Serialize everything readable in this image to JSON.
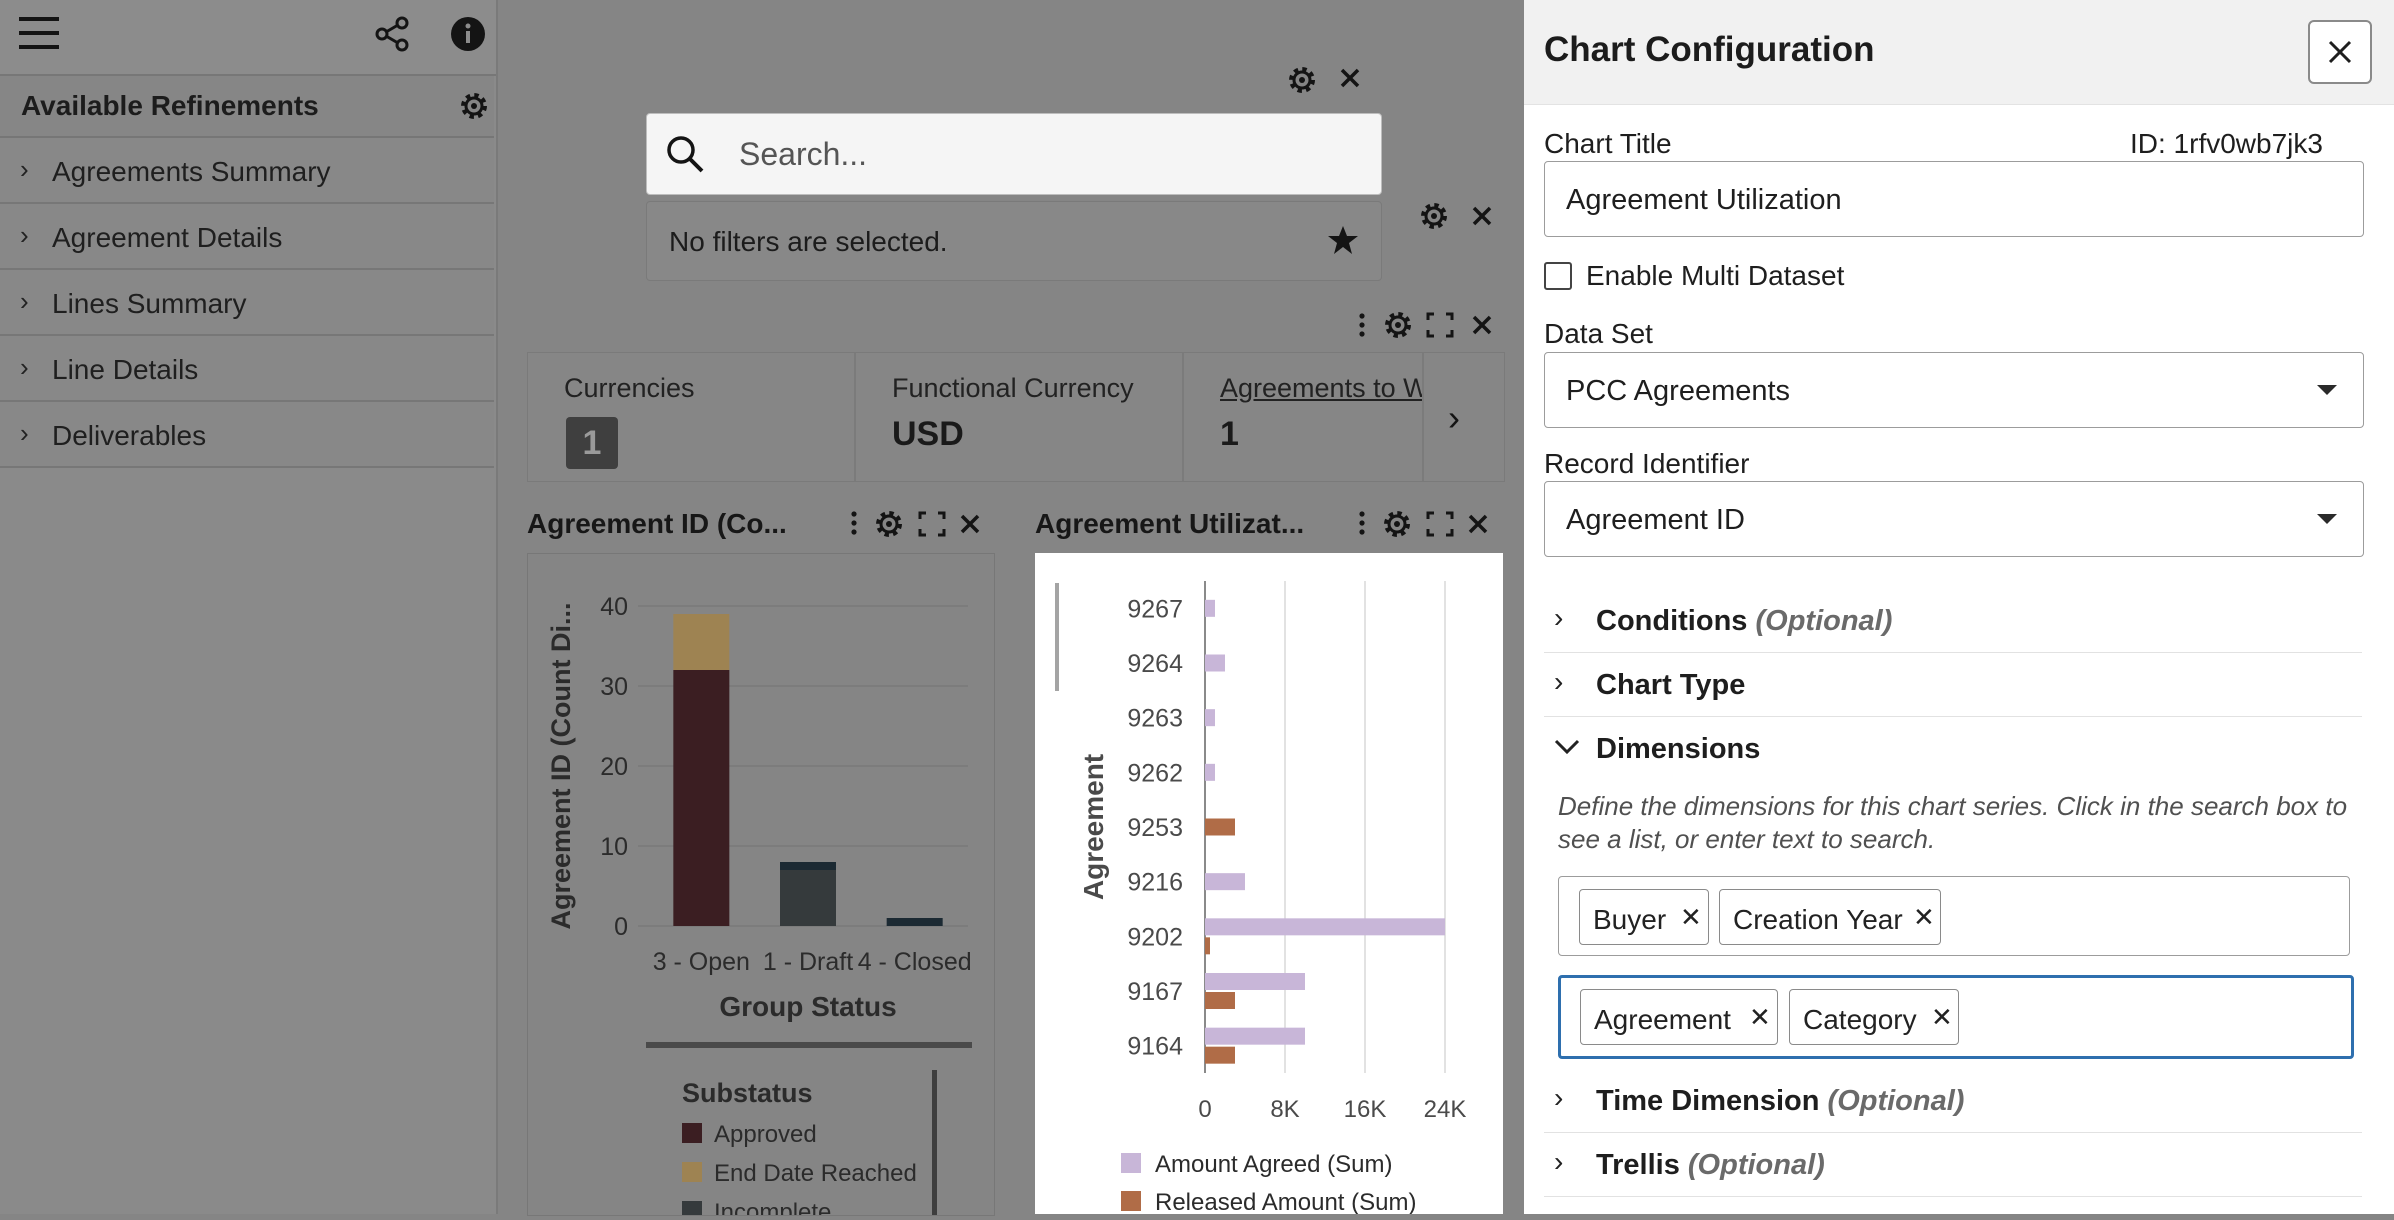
{
  "sidebar": {
    "heading": "Available Refinements",
    "items": [
      {
        "label": "Agreements Summary"
      },
      {
        "label": "Agreement Details"
      },
      {
        "label": "Lines Summary"
      },
      {
        "label": "Line Details"
      },
      {
        "label": "Deliverables"
      }
    ]
  },
  "search": {
    "placeholder": "Search..."
  },
  "filters": {
    "text": "No filters are selected."
  },
  "summary": {
    "cells": [
      {
        "header": "Currencies",
        "value": "1"
      },
      {
        "header": "Functional Currency",
        "value": "USD"
      },
      {
        "header": "Agreements to W",
        "value": "1"
      }
    ]
  },
  "chart_panels": [
    {
      "title": "Agreement ID (Co..."
    },
    {
      "title": "Agreement Utilizat..."
    }
  ],
  "chart_data": [
    {
      "type": "bar",
      "stacked": true,
      "categories": [
        "3 - Open",
        "1 - Draft",
        "4 - Closed"
      ],
      "series": [
        {
          "name": "Approved",
          "values": [
            32,
            0,
            0
          ],
          "color": "#3b1e22"
        },
        {
          "name": "End Date Reached",
          "values": [
            7,
            0,
            0
          ],
          "color": "#9e8352"
        },
        {
          "name": "Incomplete",
          "values": [
            0,
            7,
            0
          ],
          "color": "#353a3c"
        },
        {
          "name": "",
          "values": [
            0,
            1,
            1
          ],
          "color": "#1c2a33"
        }
      ],
      "xlabel": "Group Status",
      "ylabel": "Agreement ID (Count Di...",
      "ylim": [
        0,
        40
      ],
      "yticks": [
        "0",
        "10",
        "20",
        "30",
        "40"
      ],
      "legend_title": "Substatus",
      "legend_items": [
        "Approved",
        "End Date Reached",
        "Incomplete"
      ]
    },
    {
      "type": "bar",
      "orientation": "horizontal",
      "categories": [
        "9267",
        "9264",
        "9263",
        "9262",
        "9253",
        "9216",
        "9202",
        "9167",
        "9164"
      ],
      "series": [
        {
          "name": "Amount Agreed (Sum)",
          "values": [
            1000,
            2000,
            1000,
            1000,
            0,
            4000,
            24000,
            10000,
            10000
          ],
          "color": "#c8b6d8"
        },
        {
          "name": "Released Amount (Sum)",
          "values": [
            0,
            0,
            0,
            0,
            3000,
            0,
            500,
            3000,
            3000
          ],
          "color": "#b06c47"
        }
      ],
      "ylabel": "Agreement",
      "xlim": [
        0,
        26000
      ],
      "xticks": [
        "0",
        "8K",
        "16K",
        "24K"
      ]
    }
  ],
  "config": {
    "title": "Chart Configuration",
    "chart_title_label": "Chart Title",
    "id_text": "ID: 1rfv0wb7jk3",
    "chart_title_value": "Agreement Utilization",
    "multi_dataset_label": "Enable Multi Dataset",
    "data_set_label": "Data Set",
    "data_set_value": "PCC Agreements",
    "record_identifier_label": "Record Identifier",
    "record_identifier_value": "Agreement ID",
    "sections": {
      "conditions": {
        "label": "Conditions",
        "optional": "(Optional)"
      },
      "chart_type": {
        "label": "Chart Type"
      },
      "dimensions": {
        "label": "Dimensions"
      },
      "time_dimension": {
        "label": "Time Dimension",
        "optional": "(Optional)"
      },
      "trellis": {
        "label": "Trellis",
        "optional": "(Optional)"
      }
    },
    "dimensions_help": "Define the dimensions for this chart series. Click in the search box to see a list, or enter text to search.",
    "dim_row1": [
      "Buyer",
      "Creation Year"
    ],
    "dim_row2": [
      "Agreement",
      "Category"
    ]
  },
  "colors": {
    "accent_border": "#2e6fae",
    "overlay": "#858585"
  }
}
